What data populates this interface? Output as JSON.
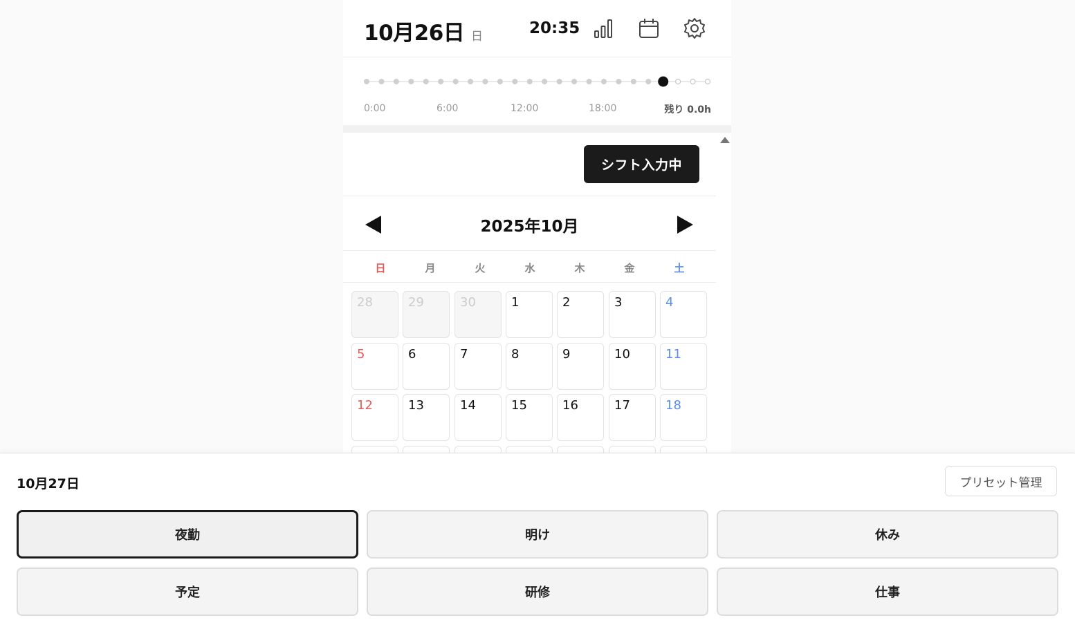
{
  "header": {
    "date": "10月26日",
    "day_of_week": "日",
    "time": "20:35",
    "icons": [
      "bar-chart-icon",
      "calendar-icon",
      "gear-icon"
    ]
  },
  "timeline": {
    "total_dots": 24,
    "current_hour": 20,
    "labels": [
      "0:00",
      "6:00",
      "12:00",
      "18:00"
    ],
    "remaining": "残り 0.0h"
  },
  "shift_mode": {
    "label": "シフト入力中"
  },
  "calendar": {
    "month_title": "2025年10月",
    "weekdays": [
      {
        "label": "日",
        "color": "#e85a5a"
      },
      {
        "label": "月",
        "color": "#888888"
      },
      {
        "label": "火",
        "color": "#888888"
      },
      {
        "label": "水",
        "color": "#888888"
      },
      {
        "label": "木",
        "color": "#888888"
      },
      {
        "label": "金",
        "color": "#888888"
      },
      {
        "label": "土",
        "color": "#5b8def"
      }
    ],
    "weeks": [
      [
        {
          "d": "28",
          "m": true
        },
        {
          "d": "29",
          "m": true
        },
        {
          "d": "30",
          "m": true
        },
        {
          "d": "1"
        },
        {
          "d": "2"
        },
        {
          "d": "3"
        },
        {
          "d": "4"
        }
      ],
      [
        {
          "d": "5"
        },
        {
          "d": "6"
        },
        {
          "d": "7"
        },
        {
          "d": "8"
        },
        {
          "d": "9"
        },
        {
          "d": "10"
        },
        {
          "d": "11"
        }
      ],
      [
        {
          "d": "12"
        },
        {
          "d": "13"
        },
        {
          "d": "14"
        },
        {
          "d": "15"
        },
        {
          "d": "16"
        },
        {
          "d": "17"
        },
        {
          "d": "18"
        }
      ],
      [
        {
          "d": ""
        },
        {
          "d": ""
        },
        {
          "d": ""
        },
        {
          "d": ""
        },
        {
          "d": ""
        },
        {
          "d": ""
        },
        {
          "d": ""
        }
      ]
    ],
    "colors": {
      "sunday": "#e85a5a",
      "saturday": "#5b8def",
      "weekday": "#111111",
      "muted": "#cccccc"
    }
  },
  "sheet": {
    "date": "10月27日",
    "preset_label": "プリセット管理",
    "shifts": [
      {
        "label": "夜勤",
        "selected": true
      },
      {
        "label": "明け",
        "selected": false
      },
      {
        "label": "休み",
        "selected": false
      },
      {
        "label": "予定",
        "selected": false
      },
      {
        "label": "研修",
        "selected": false
      },
      {
        "label": "仕事",
        "selected": false
      }
    ]
  }
}
